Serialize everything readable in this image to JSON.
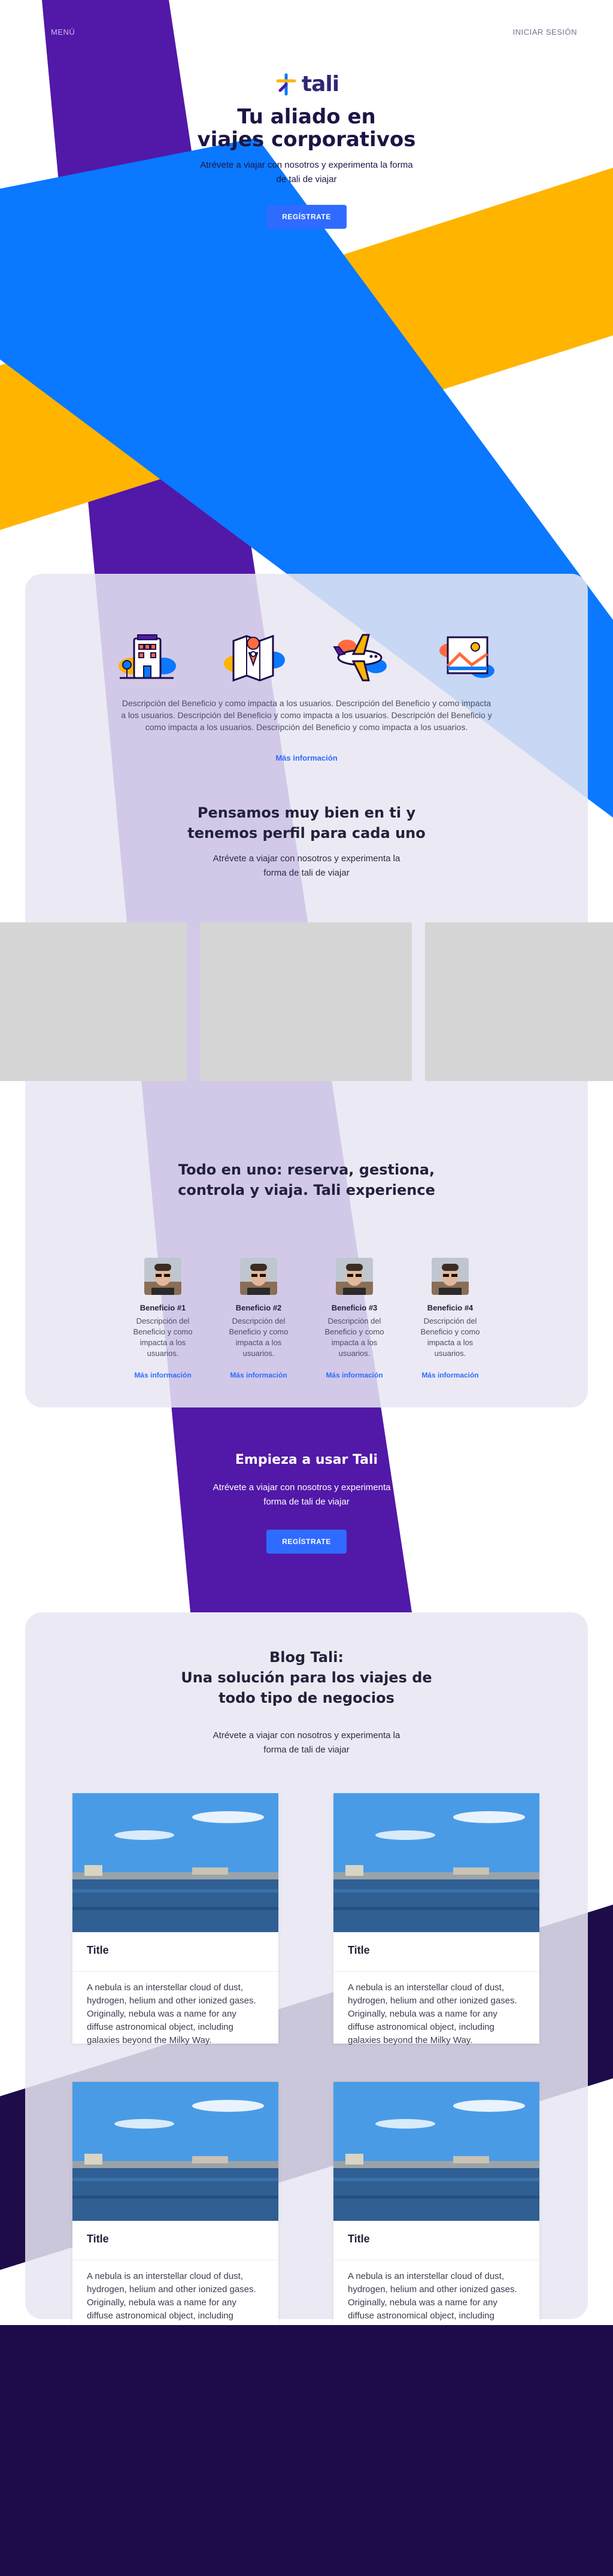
{
  "header": {
    "menu_label": "MENÚ",
    "login_label": "INICIAR SESIÓN"
  },
  "hero": {
    "logo_text": "tali",
    "title_line1": "Tu aliado en",
    "title_line2": "viajes corporativos",
    "subtitle": "Atrévete a viajar con nosotros y experimenta la forma de tali de viajar",
    "cta_label": "REGÍSTRATE"
  },
  "features": {
    "icons": [
      "hotel-icon",
      "map-pin-icon",
      "airplane-icon",
      "picture-icon"
    ],
    "description": "Descripción del Beneficio y como impacta a los usuarios. Descripción del Beneficio y como impacta a los usuarios. Descripción del Beneficio y como impacta a los usuarios. Descripción del Beneficio y como impacta a los usuarios. Descripción del Beneficio y como impacta a los usuarios.",
    "link_label": "Más información"
  },
  "profile": {
    "title": "Pensamos muy bien en ti y tenemos perfil para cada uno",
    "subtitle": "Atrévete a viajar con nosotros y experimenta la forma de tali de viajar"
  },
  "benefits": {
    "title": "Todo en uno: reserva, gestiona, controla y viaja. Tali experience",
    "items": [
      {
        "name": "Beneficio #1",
        "desc": "Descripción del Beneficio y como impacta a los usuarios.",
        "link": "Más información"
      },
      {
        "name": "Beneficio #2",
        "desc": "Descripción del Beneficio y como impacta a los usuarios.",
        "link": "Más información"
      },
      {
        "name": "Beneficio #3",
        "desc": "Descripción del Beneficio y como impacta a los usuarios.",
        "link": "Más información"
      },
      {
        "name": "Beneficio #4",
        "desc": "Descripción del Beneficio y como impacta a los usuarios.",
        "link": "Más información"
      }
    ]
  },
  "cta": {
    "title": "Empieza a usar Tali",
    "subtitle": "Atrévete a viajar con nosotros y experimenta la forma de tali de viajar",
    "button_label": "REGÍSTRATE"
  },
  "blog": {
    "title_line1": "Blog Tali:",
    "title_line2": "Una solución para los viajes de todo tipo de negocios",
    "subtitle": "Atrévete a viajar con nosotros y experimenta la forma de tali de viajar",
    "posts": [
      {
        "title": "Title",
        "text": "A nebula is an interstellar cloud of dust, hydrogen, helium and other ionized gases. Originally, nebula was a name for any diffuse astronomical object, including galaxies beyond the Milky Way."
      },
      {
        "title": "Title",
        "text": "A nebula is an interstellar cloud of dust, hydrogen, helium and other ionized gases. Originally, nebula was a name for any diffuse astronomical object, including galaxies beyond the Milky Way."
      },
      {
        "title": "Title",
        "text": "A nebula is an interstellar cloud of dust, hydrogen, helium and other ionized gases. Originally, nebula was a name for any diffuse astronomical object, including galaxies beyond the Milky Way."
      },
      {
        "title": "Title",
        "text": "A nebula is an interstellar cloud of dust, hydrogen, helium and other ionized gases. Originally, nebula was a name for any diffuse astronomical object, including galaxies beyond the Milky Way."
      }
    ]
  },
  "colors": {
    "purple": "#5218a8",
    "blue": "#0a78ff",
    "yellow": "#ffb400",
    "navy": "#1d0b4a",
    "accent_button": "#2f6bff"
  }
}
